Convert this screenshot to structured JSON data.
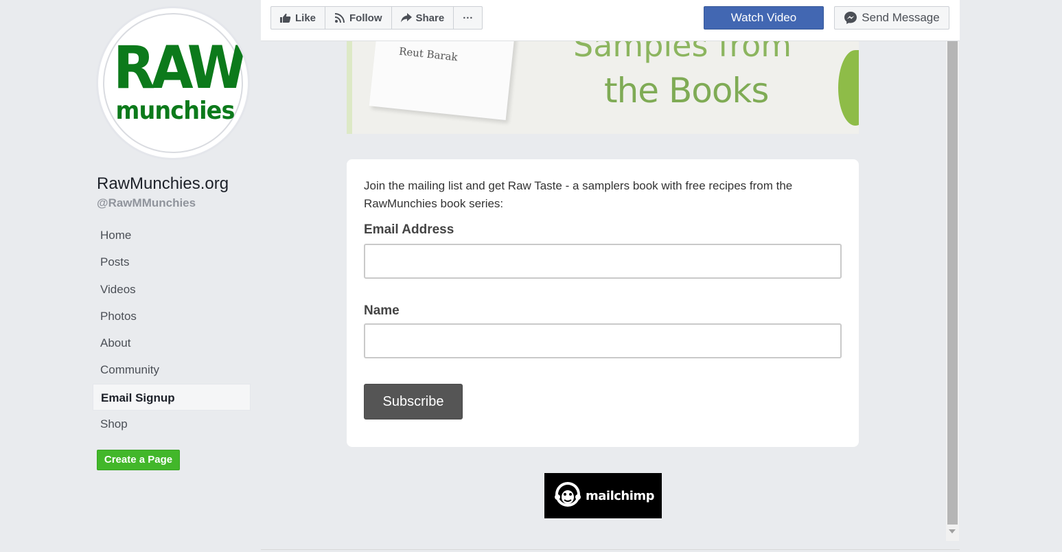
{
  "profile": {
    "logo_line1": "RAW",
    "logo_line2": "munchies",
    "page_name": "RawMunchies.org",
    "handle": "@RawMMunchies"
  },
  "nav": {
    "items": [
      {
        "label": "Home",
        "active": false
      },
      {
        "label": "Posts",
        "active": false
      },
      {
        "label": "Videos",
        "active": false
      },
      {
        "label": "Photos",
        "active": false
      },
      {
        "label": "About",
        "active": false
      },
      {
        "label": "Community",
        "active": false
      },
      {
        "label": "Email Signup",
        "active": true
      },
      {
        "label": "Shop",
        "active": false
      }
    ],
    "create_page": "Create a Page"
  },
  "toolbar": {
    "like": "Like",
    "follow": "Follow",
    "share": "Share",
    "more": "···",
    "watch_video": "Watch Video",
    "send_message": "Send Message"
  },
  "banner": {
    "author": "Reut Barak",
    "title_top": "Samples from",
    "title": "the Books"
  },
  "form": {
    "intro": "Join the mailing list and get Raw Taste - a samplers book with free recipes from the RawMunchies book series:",
    "email_label": "Email Address",
    "email_value": "",
    "name_label": "Name",
    "name_value": "",
    "subscribe": "Subscribe"
  },
  "footer": {
    "mailchimp": "mailchimp"
  },
  "colors": {
    "brand_green": "#0c7a1b",
    "facebook_blue": "#4267b2",
    "create_green": "#42b72a"
  }
}
